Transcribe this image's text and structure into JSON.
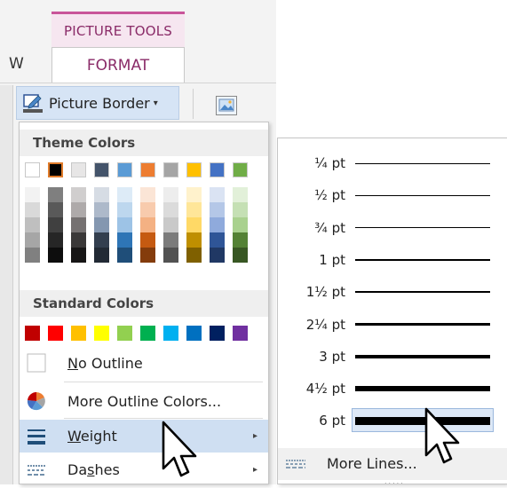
{
  "ribbon": {
    "context_tab": "PICTURE TOOLS",
    "partial_tab": "W",
    "format_tab": "FORMAT",
    "picture_border_label": "Picture Border",
    "picture_border_caret": "▾"
  },
  "menu": {
    "theme_colors_heading": "Theme Colors",
    "standard_colors_heading": "Standard Colors",
    "theme_top_row": [
      "#ffffff",
      "#000000",
      "#e7e6e6",
      "#44546a",
      "#5b9bd5",
      "#ed7d31",
      "#a5a5a5",
      "#ffc000",
      "#4472c4",
      "#70ad47"
    ],
    "theme_shades": [
      [
        "#f2f2f2",
        "#d9d9d9",
        "#bfbfbf",
        "#a6a6a6",
        "#808080"
      ],
      [
        "#7f7f7f",
        "#595959",
        "#404040",
        "#262626",
        "#0d0d0d"
      ],
      [
        "#d0cece",
        "#aeaaaa",
        "#757171",
        "#3a3838",
        "#171616"
      ],
      [
        "#d6dce4",
        "#adb9ca",
        "#8497b0",
        "#333f4f",
        "#222a35"
      ],
      [
        "#ddebf7",
        "#bdd7ee",
        "#9dc3e6",
        "#2e75b6",
        "#1f4e79"
      ],
      [
        "#fbe5d6",
        "#f8cbad",
        "#f4b183",
        "#c55a11",
        "#843c0c"
      ],
      [
        "#ededed",
        "#dbdbdb",
        "#c9c9c9",
        "#7b7b7b",
        "#525252"
      ],
      [
        "#fff2cc",
        "#ffe699",
        "#ffd966",
        "#bf8f00",
        "#7f6000"
      ],
      [
        "#dae3f3",
        "#b4c7e7",
        "#8faadc",
        "#2f5597",
        "#203864"
      ],
      [
        "#e2f0d9",
        "#c5e0b4",
        "#a9d18e",
        "#548235",
        "#385723"
      ]
    ],
    "standard_row": [
      "#c00000",
      "#ff0000",
      "#ffc000",
      "#ffff00",
      "#92d050",
      "#00b050",
      "#00b0f0",
      "#0070c0",
      "#002060",
      "#7030a0"
    ],
    "no_outline_label": "No Outline",
    "more_outline_colors_label": "More Outline Colors...",
    "weight_label": "Weight",
    "dashes_label": "Dashes",
    "submenu_arrow": "▸"
  },
  "weight_submenu": {
    "items": [
      "¼ pt",
      "½ pt",
      "¾ pt",
      "1 pt",
      "1½ pt",
      "2¼ pt",
      "3 pt",
      "4½ pt",
      "6 pt"
    ],
    "selected_index": 8,
    "more_lines_label": "More Lines...",
    "grip": "....."
  }
}
